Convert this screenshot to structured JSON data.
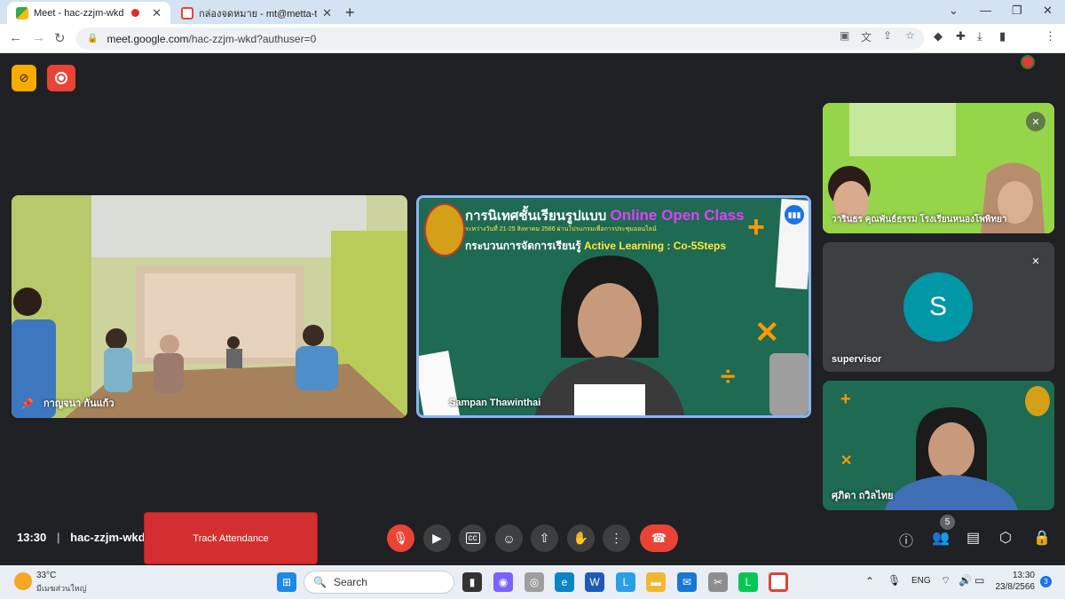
{
  "browser": {
    "tabs": [
      {
        "title": "Meet - hac-zzjm-wkd",
        "active": true,
        "recording": true
      },
      {
        "title": "กล่องจดหมาย - mt@metta-tt.info -",
        "active": false
      }
    ],
    "new_tab": "+",
    "url_host": "meet.google.com",
    "url_path": "/hac-zzjm-wkd?authuser=0"
  },
  "meet": {
    "meeting_code": "hac-zzjm-wkd",
    "time": "13:30",
    "track_attendance_label": "Track Attendance",
    "participant_count": "5",
    "participants": [
      {
        "name": "กาญจนา กันแก้ว",
        "pinned": true
      },
      {
        "name": "Sampan Thawinthai",
        "speaking": true
      },
      {
        "name": "วารินธร คุณพันธ์ธรรม โรงเรียนหนองโพพิทยา",
        "muted": true
      },
      {
        "name": "supervisor",
        "initial": "S",
        "muted": true,
        "avatar_color": "#0097a7"
      },
      {
        "name": "ศุภิดา ถวิลไทย"
      }
    ],
    "slide": {
      "title_th": "การนิเทศชั้นเรียนรูปแบบ",
      "title_en": "Online Open Class",
      "subtitle": "กระบวนการจัดการเรียนรู้",
      "subtitle_en": "Active Learning : Co-5Steps",
      "date_line": "ระหว่างวันที่ 21-25 สิงหาคม 2566 ผ่านโปรแกรมเพื่อการประชุมออนไลน์"
    }
  },
  "taskbar": {
    "weather_temp": "33°C",
    "weather_desc": "มีเมฆส่วนใหญ่",
    "search_placeholder": "Search",
    "lang": "ENG",
    "clock_time": "13:30",
    "clock_date": "23/8/2566",
    "notifications": "3"
  },
  "colors": {
    "accent_blue": "#8ab4f8",
    "danger": "#ea4335",
    "meet_bg": "#202124"
  }
}
